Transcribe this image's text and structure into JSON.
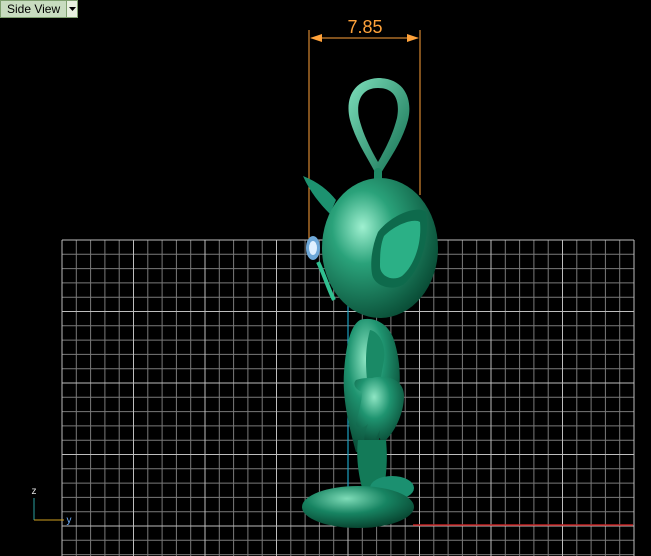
{
  "view": {
    "label": "Side View",
    "menu_icon": "chevron-down-icon"
  },
  "dimension": {
    "value": "7.85",
    "color": "#ffa23a"
  },
  "axes": {
    "vertical": "z",
    "horizontal": "y"
  },
  "colors": {
    "background": "#000000",
    "grid": "#7a7a7a",
    "model": "#1a8c66",
    "axis_y_line": "#c02020",
    "axis_z_line": "#1aa0c0"
  }
}
